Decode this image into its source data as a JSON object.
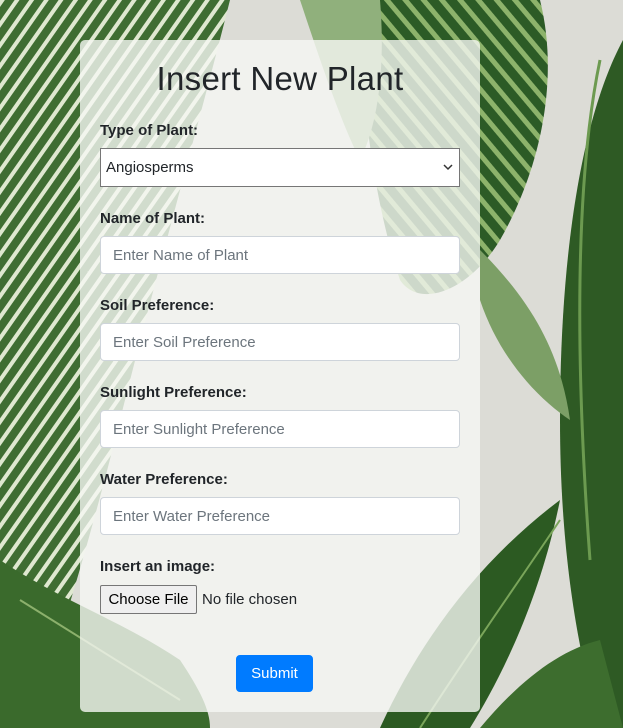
{
  "form": {
    "title": "Insert New Plant",
    "type": {
      "label": "Type of Plant:",
      "selected": "Angiosperms"
    },
    "name": {
      "label": "Name of Plant:",
      "placeholder": "Enter Name of Plant"
    },
    "soil": {
      "label": "Soil Preference:",
      "placeholder": "Enter Soil Preference"
    },
    "sunlight": {
      "label": "Sunlight Preference:",
      "placeholder": "Enter Sunlight Preference"
    },
    "water": {
      "label": "Water Preference:",
      "placeholder": "Enter Water Preference"
    },
    "image": {
      "label": "Insert an image:",
      "button": "Choose File",
      "status": "No file chosen"
    },
    "submit": "Submit"
  },
  "colors": {
    "accent": "#007bff",
    "card_bg": "rgba(246,247,244,0.80)",
    "leaf_dark": "#2f5a2a",
    "leaf_light": "#8fb07a",
    "background": "#dcdcd6"
  },
  "icons": {
    "select_arrow": "chevron-down-icon"
  }
}
